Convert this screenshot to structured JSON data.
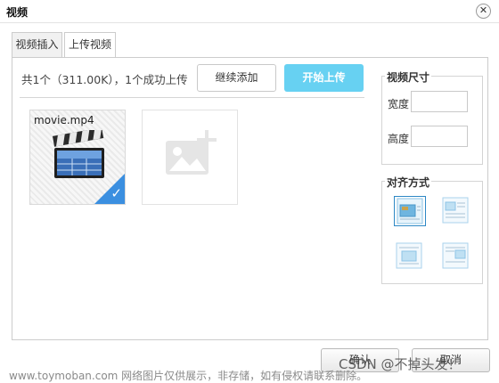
{
  "dialog": {
    "title": "视频",
    "close_glyph": "✕"
  },
  "tabs": [
    {
      "label": "视频插入",
      "active": false
    },
    {
      "label": "上传视频",
      "active": true
    }
  ],
  "upload": {
    "status_text": "共1个（311.00K），1个成功上传",
    "continue_label": "继续添加",
    "start_label": "开始上传",
    "start_button_color": "#67d1f2",
    "file": {
      "name": "movie.mp4",
      "icon": "video-clapperboard-icon",
      "uploaded": true,
      "check_glyph": "✓",
      "check_color": "#3b8fe0"
    },
    "add_placeholder_icon": "add-image-icon"
  },
  "video_size": {
    "legend": "视频尺寸",
    "width_label": "宽度",
    "width_value": "",
    "height_label": "高度",
    "height_value": ""
  },
  "alignment": {
    "legend": "对齐方式",
    "options": [
      {
        "icon": "align-none-icon",
        "selected": true
      },
      {
        "icon": "align-left-icon",
        "selected": false
      },
      {
        "icon": "align-right-icon",
        "selected": false
      },
      {
        "icon": "align-center-icon",
        "selected": false
      }
    ]
  },
  "footer": {
    "ok_label": "确认",
    "cancel_label": "取消"
  },
  "watermark": {
    "site_text": "www.toymoban.com 网络图片仅供展示，非存储，如有侵权请联系删除。",
    "author_text": "CSDN @不掉头发！"
  }
}
